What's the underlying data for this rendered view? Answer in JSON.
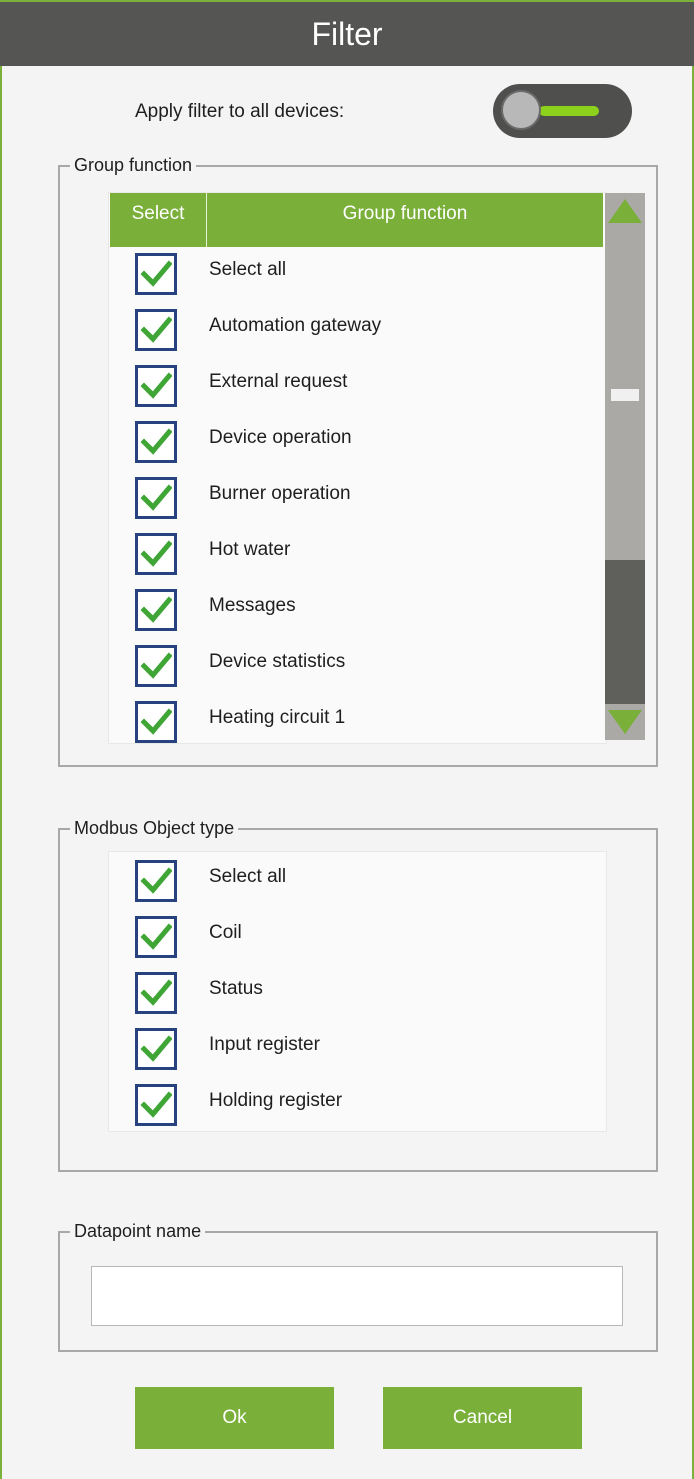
{
  "dialog": {
    "title": "Filter"
  },
  "apply_filter": {
    "label": "Apply filter to all devices:",
    "enabled": true,
    "accent": "#8cd11c"
  },
  "group_function": {
    "legend": "Group function",
    "columns": {
      "select": "Select",
      "name": "Group function"
    },
    "items": [
      {
        "label": "Select all",
        "checked": true
      },
      {
        "label": "Automation gateway",
        "checked": true
      },
      {
        "label": "External request",
        "checked": true
      },
      {
        "label": "Device operation",
        "checked": true
      },
      {
        "label": "Burner operation",
        "checked": true
      },
      {
        "label": "Hot water",
        "checked": true
      },
      {
        "label": "Messages",
        "checked": true
      },
      {
        "label": "Device statistics",
        "checked": true
      },
      {
        "label": "Heating circuit 1",
        "checked": true
      }
    ]
  },
  "modbus_object_type": {
    "legend": "Modbus Object type",
    "items": [
      {
        "label": "Select all",
        "checked": true
      },
      {
        "label": "Coil",
        "checked": true
      },
      {
        "label": "Status",
        "checked": true
      },
      {
        "label": "Input register",
        "checked": true
      },
      {
        "label": "Holding register",
        "checked": true
      }
    ]
  },
  "datapoint_name": {
    "legend": "Datapoint name",
    "value": "",
    "placeholder": ""
  },
  "buttons": {
    "ok": "Ok",
    "cancel": "Cancel"
  },
  "colors": {
    "header": "#555553",
    "accent": "#7aaf3a",
    "checkbox_border": "#26437f",
    "check": "#3fa535"
  }
}
